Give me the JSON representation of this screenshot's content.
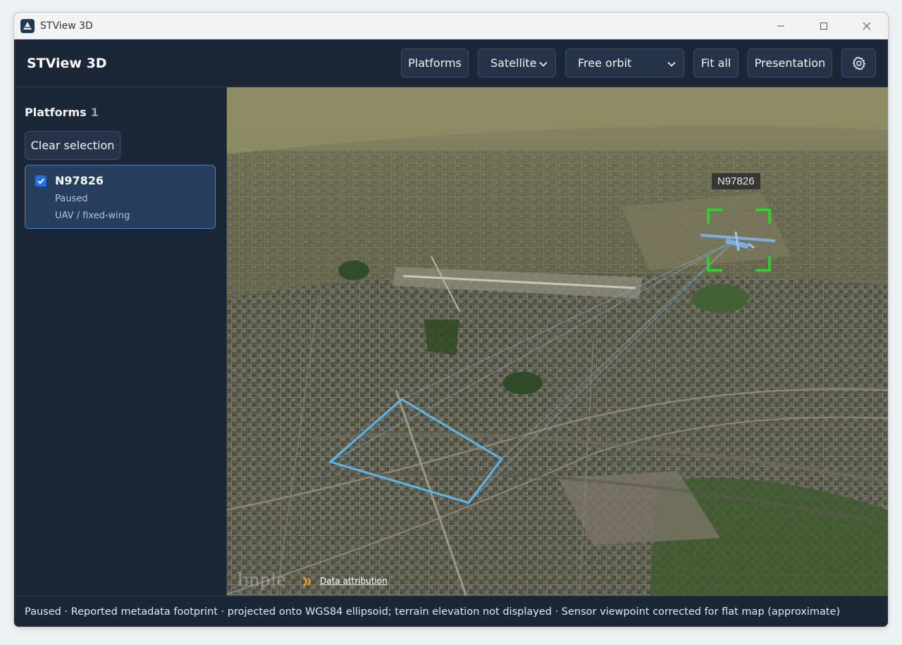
{
  "window": {
    "title": "STView 3D"
  },
  "header": {
    "brand": "STView 3D",
    "buttons": {
      "platforms": "Platforms",
      "basemap": "Satellite",
      "camera": "Free orbit",
      "fit_all": "Fit all",
      "presentation": "Presentation"
    }
  },
  "sidebar": {
    "title": "Platforms",
    "count": "1",
    "clear_label": "Clear selection",
    "items": [
      {
        "name": "N97826",
        "status": "Paused",
        "type": "UAV / fixed-wing",
        "checked": true
      }
    ]
  },
  "map": {
    "target_label": "N97826",
    "watermark": "Imple",
    "attribution": "Data attribution"
  },
  "statusbar": {
    "text": "Paused · Reported metadata footprint · projected onto WGS84 ellipsoid; terrain elevation not displayed · Sensor viewpoint corrected for flat map (approximate)"
  },
  "colors": {
    "app_bg": "#1b2636",
    "button_bg": "#26344a",
    "selected_card": "#263e5c",
    "footprint": "#5ab6ec",
    "target_box": "#22dd22",
    "checkbox": "#1d6ff2"
  }
}
